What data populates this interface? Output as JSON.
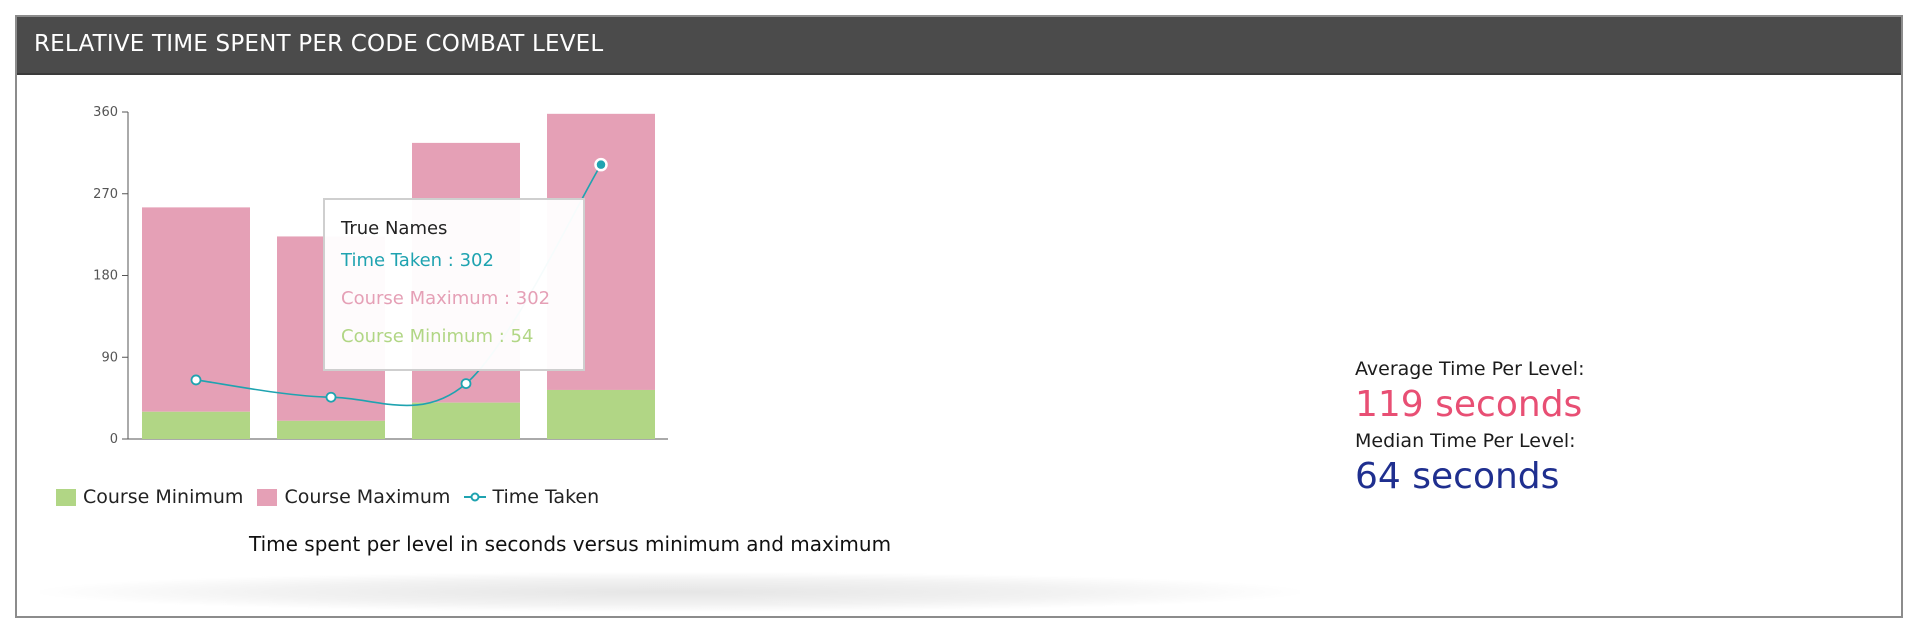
{
  "header": {
    "title": "RELATIVE TIME SPENT PER CODE COMBAT LEVEL"
  },
  "colors": {
    "course_minimum": "#b1d685",
    "course_maximum": "#e5a0b6",
    "time_taken": "#1fa3b0",
    "average_value": "#e84f74",
    "median_value": "#1f2f8f"
  },
  "chart_data": {
    "type": "bar",
    "categories": [
      "",
      "",
      "",
      ""
    ],
    "series": [
      {
        "name": "Course Minimum",
        "values": [
          30,
          20,
          40,
          54
        ]
      },
      {
        "name": "Course Maximum",
        "values": [
          255,
          223,
          326,
          358
        ]
      },
      {
        "name": "Time Taken",
        "type": "line",
        "values": [
          65,
          46,
          61,
          302
        ]
      }
    ],
    "ylim": [
      0,
      360
    ],
    "yticks": [
      0,
      90,
      180,
      270,
      360
    ],
    "xlabel": "",
    "ylabel": "",
    "stacked": true,
    "legend": "bottom-left",
    "grid": false
  },
  "tooltip": {
    "title": "True Names",
    "time_taken": "Time Taken : 302",
    "course_maximum": "Course Maximum : 302",
    "course_minimum": "Course Minimum : 54"
  },
  "legend": {
    "course_minimum": "Course Minimum",
    "course_maximum": "Course Maximum",
    "time_taken": "Time Taken"
  },
  "caption": "Time spent per level in seconds versus minimum and maximum",
  "stats": {
    "average_label": "Average Time Per Level:",
    "average_value": "119 seconds",
    "median_label": "Median Time Per Level:",
    "median_value": "64 seconds"
  }
}
